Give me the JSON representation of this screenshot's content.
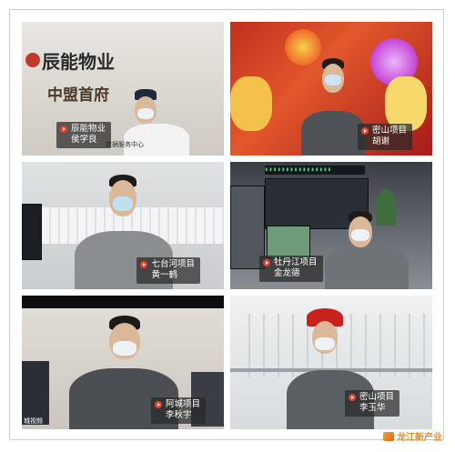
{
  "tiles": [
    {
      "wall_sign_1": "辰能物业",
      "wall_sign_2": "中盟首府",
      "side_text": "数据服务中心",
      "caption": [
        "辰能物业",
        "侯学良"
      ]
    },
    {
      "caption": [
        "密山项目",
        "胡谢"
      ]
    },
    {
      "caption": [
        "七台河项目",
        "黄一鹤"
      ]
    },
    {
      "caption": [
        "牡丹江项目",
        "金龙德"
      ]
    },
    {
      "corner_text": "城视频",
      "caption": [
        "阿城项目",
        "李秋宇"
      ]
    },
    {
      "caption": [
        "密山项目",
        "李玉华"
      ]
    }
  ],
  "watermark": "龙江新产业",
  "colors": {
    "caption_bg": "#282828",
    "caption_dot": "#e8412c",
    "helmet": "#c9221c",
    "watermark": "#e38b2a"
  },
  "icons": [
    "play-dot-icon",
    "watermark-logo-icon"
  ]
}
